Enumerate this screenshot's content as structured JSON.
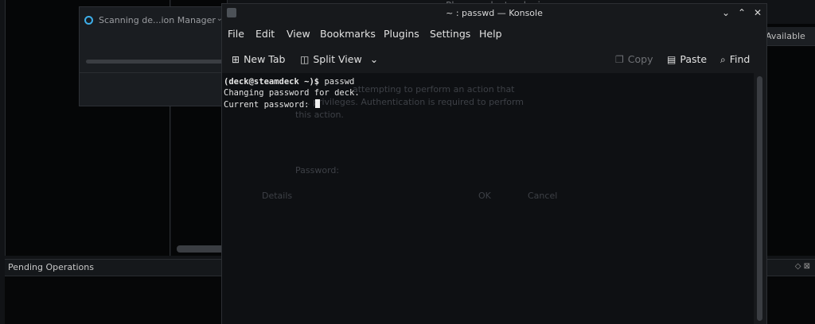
{
  "background_app": {
    "select_device_hint": "Please select a device",
    "available_label": "Available",
    "pending_operations": "Pending Operations"
  },
  "scan_popup": {
    "title": "Scanning de...ion Manager"
  },
  "konsole": {
    "title": "~ : passwd — Konsole",
    "menu": [
      "File",
      "Edit",
      "View",
      "Bookmarks",
      "Plugins",
      "Settings",
      "Help"
    ],
    "toolbar": {
      "new_tab": "New Tab",
      "split_view": "Split View",
      "copy": "Copy",
      "paste": "Paste",
      "find": "Find"
    },
    "terminal": {
      "prompt": "(deck@steamdeck ~)$ ",
      "command": "passwd",
      "line2": "Changing password for deck.",
      "line3": "Current password: "
    }
  },
  "ghost_dialog": {
    "text1": "... attempting to perform an action that",
    "text2": "... privileges. Authentication is required to perform",
    "text3": "this action.",
    "password_label": "Password:",
    "details": "Details",
    "ok": "OK",
    "cancel": "Cancel"
  },
  "colors": {
    "accent": "#3daee9",
    "terminal_bg": "#0e1013",
    "window_bg": "#17191c"
  },
  "icons": {
    "scan": "partition-manager-icon",
    "new_tab": "new-tab-icon",
    "split_view": "split-view-icon",
    "copy": "copy-icon",
    "paste": "paste-icon",
    "find": "search-icon"
  }
}
